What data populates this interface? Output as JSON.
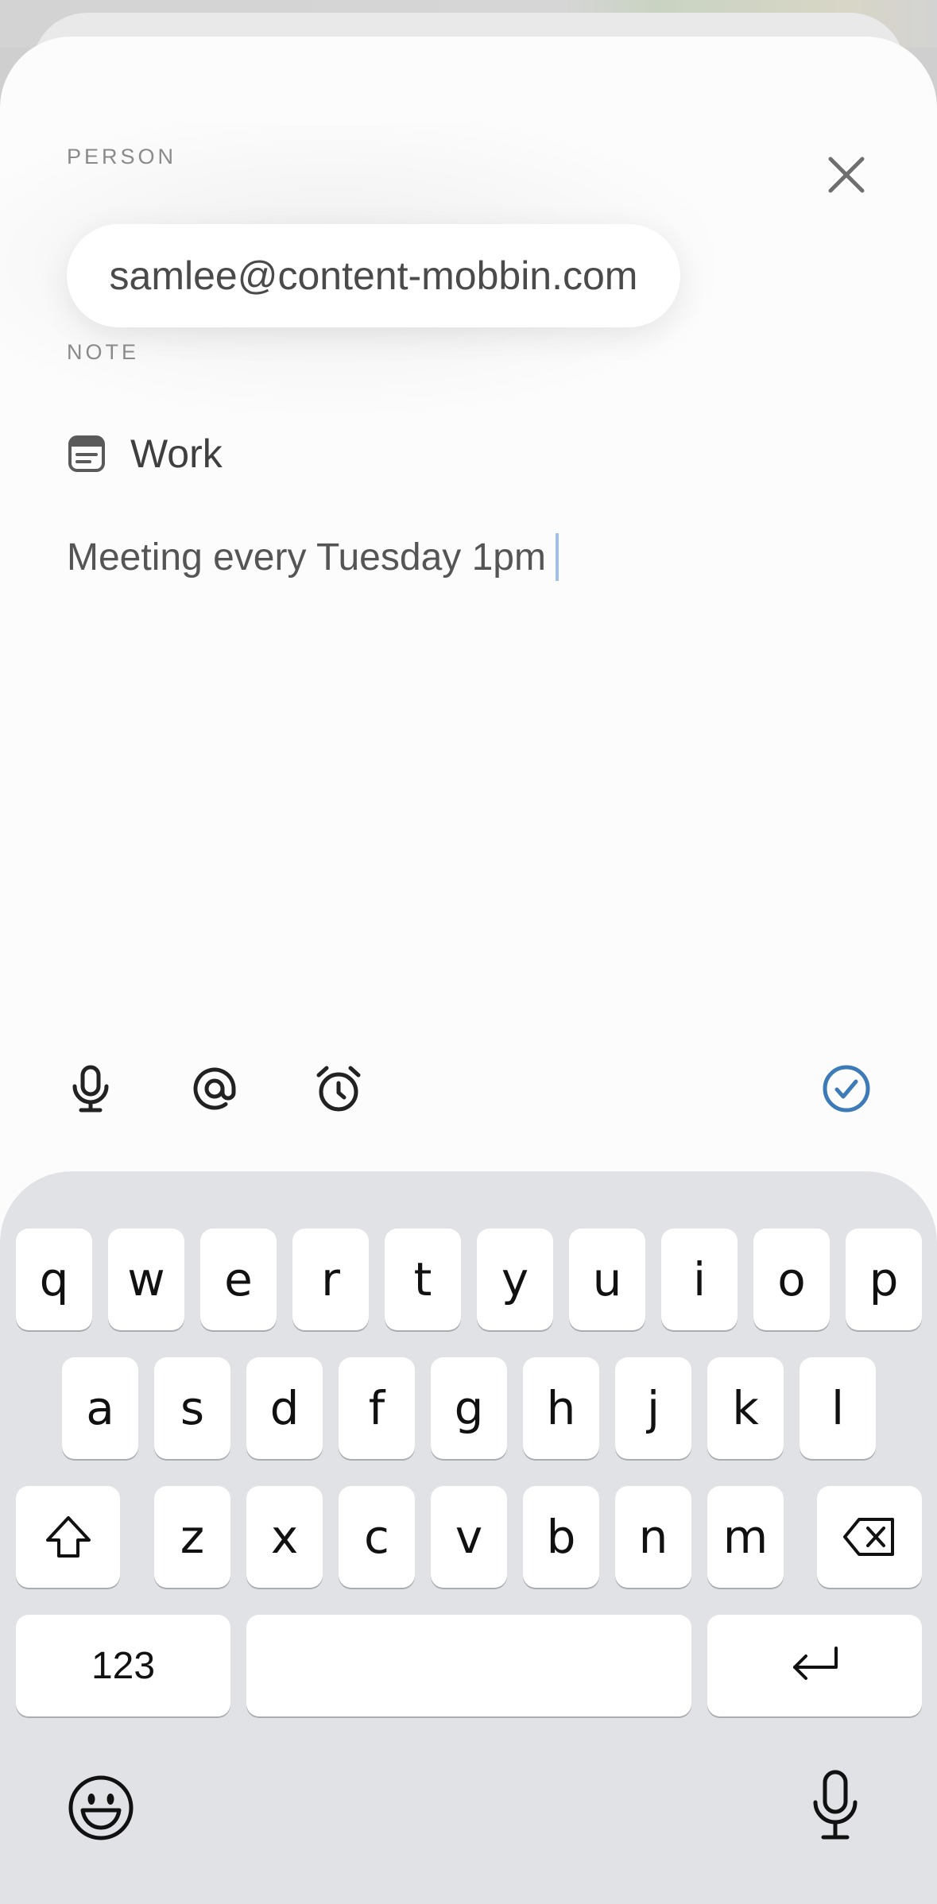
{
  "person": {
    "section_label": "PERSON",
    "email": "samlee@content-mobbin.com"
  },
  "note": {
    "section_label": "NOTE",
    "title": "Work",
    "body": "Meeting every Tuesday 1pm"
  },
  "icons": {
    "close": "close-icon",
    "note": "note-icon",
    "mic": "microphone-icon",
    "mention": "at-sign-icon",
    "reminder": "alarm-clock-icon",
    "done": "checkmark-circle-icon",
    "shift": "shift-icon",
    "delete": "backspace-icon",
    "return": "return-icon",
    "emoji": "emoji-icon",
    "dictation": "dictation-microphone-icon"
  },
  "colors": {
    "accent": "#3d7ab8",
    "caret": "#9ec0e6",
    "keyboard_bg": "#e0e2e5"
  },
  "keyboard": {
    "row1": [
      "q",
      "w",
      "e",
      "r",
      "t",
      "y",
      "u",
      "i",
      "o",
      "p"
    ],
    "row2": [
      "a",
      "s",
      "d",
      "f",
      "g",
      "h",
      "j",
      "k",
      "l"
    ],
    "row3": [
      "z",
      "x",
      "c",
      "v",
      "b",
      "n",
      "m"
    ],
    "numbers_key": "123",
    "space_key": ""
  }
}
